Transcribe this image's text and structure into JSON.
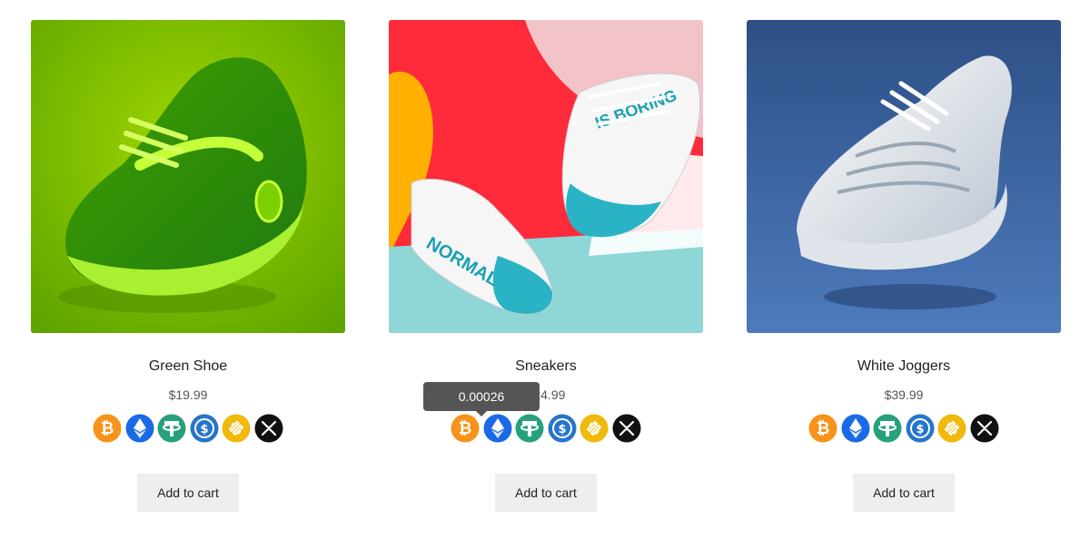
{
  "products": [
    {
      "title": "Green Shoe",
      "price": "$19.99",
      "add_to_cart": "Add to cart"
    },
    {
      "title": "Sneakers",
      "price": "$24.99",
      "add_to_cart": "Add to cart"
    },
    {
      "title": "White Joggers",
      "price": "$39.99",
      "add_to_cart": "Add to cart"
    }
  ],
  "tooltip": {
    "value": "0.00026"
  },
  "coins": [
    {
      "icon": "bitcoin-icon",
      "color": "#f7931a"
    },
    {
      "icon": "ethereum-icon",
      "color": "#1a6ae6"
    },
    {
      "icon": "tether-icon",
      "color": "#26a17b"
    },
    {
      "icon": "usd-coin-icon",
      "color": "#2775ca"
    },
    {
      "icon": "binance-usd-icon",
      "color": "#f0b90b"
    },
    {
      "icon": "xrp-icon",
      "color": "#111111"
    }
  ],
  "image_colors": {
    "green_bg": "#7ac700",
    "blue_bg": "#3e6cad"
  }
}
